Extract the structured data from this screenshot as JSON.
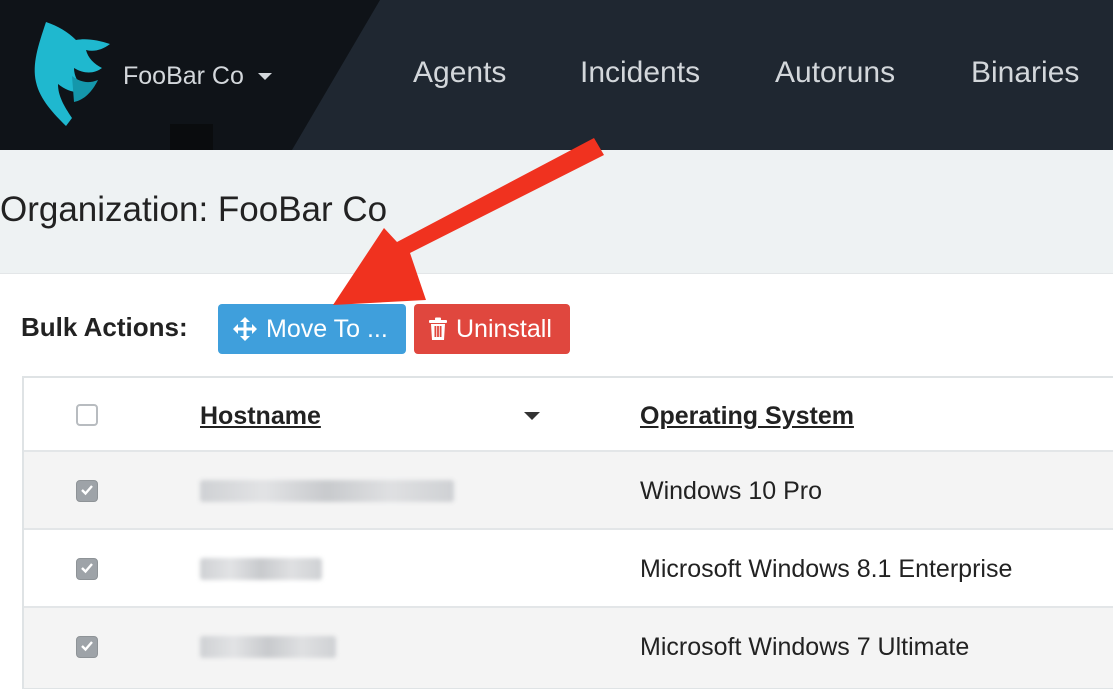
{
  "org_switcher": {
    "name": "FooBar Co"
  },
  "nav": {
    "items": [
      "Agents",
      "Incidents",
      "Autoruns",
      "Binaries"
    ]
  },
  "page": {
    "title": "Organization: FooBar Co"
  },
  "bulk_actions": {
    "label": "Bulk Actions:",
    "move_button": "Move To ...",
    "uninstall_button": "Uninstall"
  },
  "table": {
    "columns": [
      "Hostname",
      "Operating System"
    ],
    "rows": [
      {
        "checked": true,
        "os": "Windows 10 Pro"
      },
      {
        "checked": true,
        "os": "Microsoft Windows 8.1 Enterprise"
      },
      {
        "checked": true,
        "os": "Microsoft Windows 7 Ultimate"
      }
    ]
  },
  "colors": {
    "navbar": "#1f2731",
    "logo": "#1fb8cf",
    "move_button": "#3f9fdc",
    "uninstall_button": "#e0473e",
    "annotation_arrow": "#f0321f"
  },
  "icons": [
    "logo-icon",
    "caret-down-icon",
    "move-icon",
    "trash-icon",
    "sort-caret-icon",
    "check-icon"
  ]
}
